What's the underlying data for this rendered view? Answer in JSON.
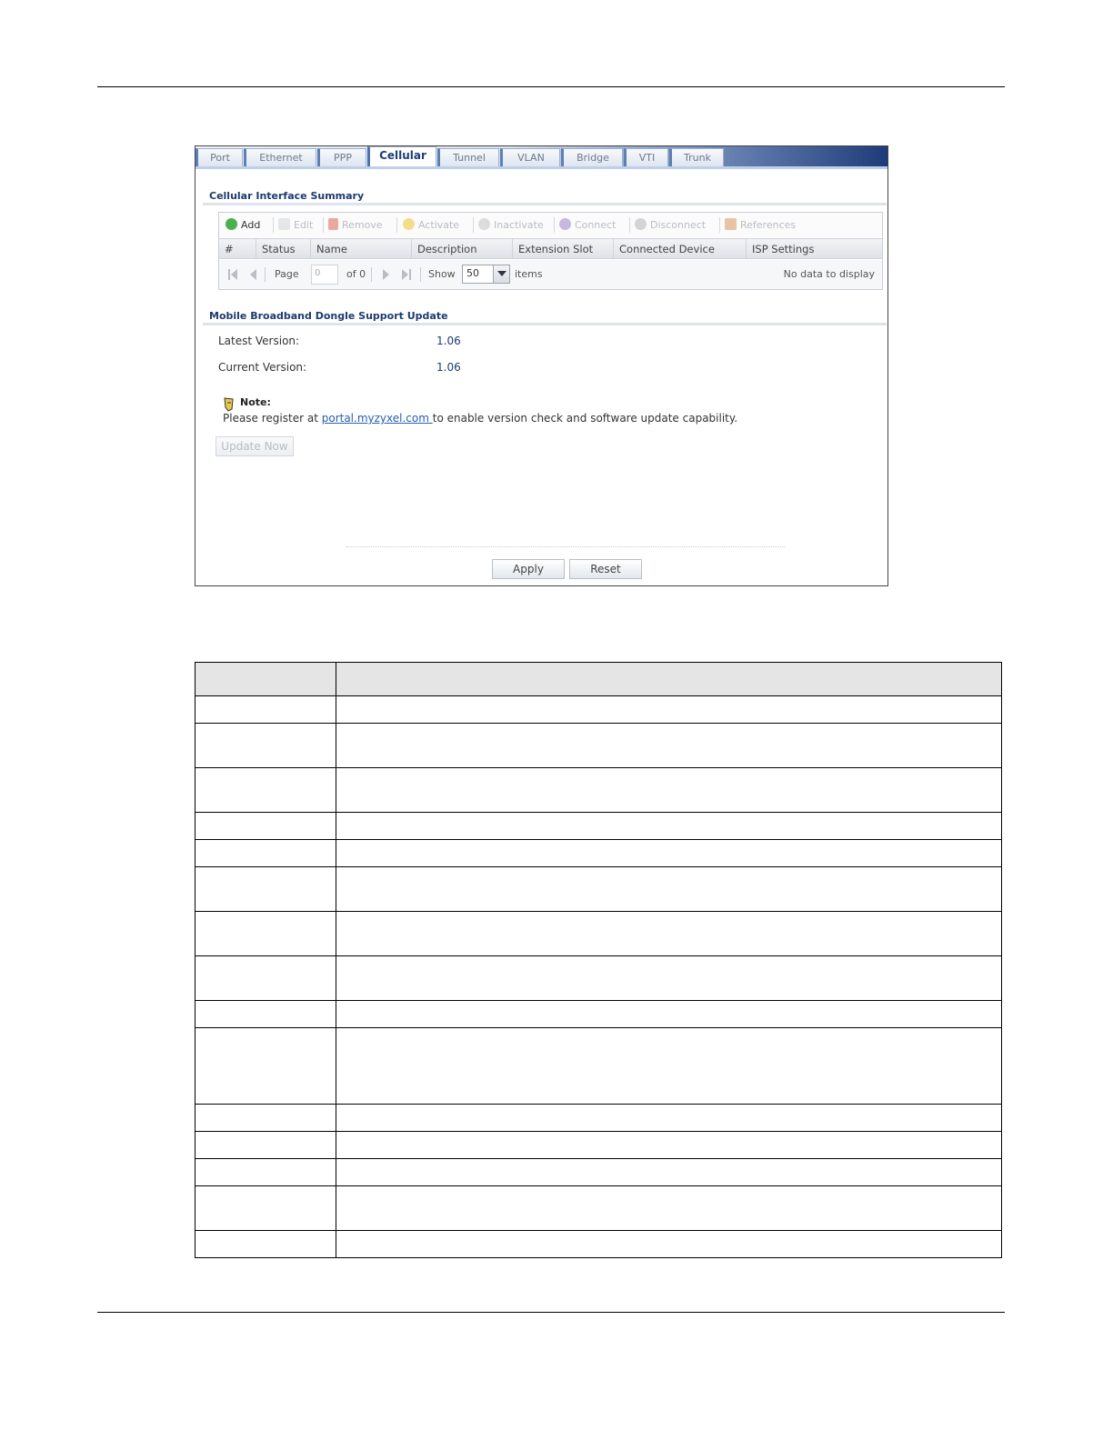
{
  "tabs": [
    "Port",
    "Ethernet",
    "PPP",
    "Cellular",
    "Tunnel",
    "VLAN",
    "Bridge",
    "VTI",
    "Trunk"
  ],
  "active_tab": "Cellular",
  "summary": {
    "title": "Cellular Interface Summary",
    "toolbar": {
      "add": "Add",
      "edit": "Edit",
      "remove": "Remove",
      "activate": "Activate",
      "inactivate": "Inactivate",
      "connect": "Connect",
      "disconnect": "Disconnect",
      "references": "References"
    },
    "columns": [
      "#",
      "Status",
      "Name",
      "Description",
      "Extension Slot",
      "Connected Device",
      "ISP Settings"
    ],
    "pager": {
      "page_label": "Page",
      "page_value": "0",
      "of_label": "of 0",
      "show_label": "Show",
      "show_value": "50",
      "items_label": "items",
      "empty_message": "No data to display"
    }
  },
  "dongle": {
    "title": "Mobile Broadband Dongle Support Update",
    "latest_label": "Latest Version:",
    "latest_value": "1.06",
    "current_label": "Current Version:",
    "current_value": "1.06",
    "note_title": "Note:",
    "note_prefix": "Please register at ",
    "note_link": "portal.myzyxel.com ",
    "note_suffix": "to enable version check and software update capability.",
    "update_button": "Update Now"
  },
  "footer": {
    "apply": "Apply",
    "reset": "Reset"
  },
  "colors": {
    "accent": "#1e3a6e",
    "link": "#2a5bb0",
    "add_icon": "#4caf50",
    "remove_icon": "#e07a6a",
    "activate_icon": "#f2d26b",
    "table_header": "#e5e5e5"
  },
  "doc_table": {
    "header": [
      "",
      ""
    ],
    "rows": [
      {
        "h": 30
      },
      {
        "h": 49
      },
      {
        "h": 49
      },
      {
        "h": 30
      },
      {
        "h": 30
      },
      {
        "h": 49
      },
      {
        "h": 49
      },
      {
        "h": 49
      },
      {
        "h": 30
      },
      {
        "h": 84
      },
      {
        "h": 30
      },
      {
        "h": 30
      },
      {
        "h": 30
      },
      {
        "h": 49
      },
      {
        "h": 30
      }
    ]
  }
}
